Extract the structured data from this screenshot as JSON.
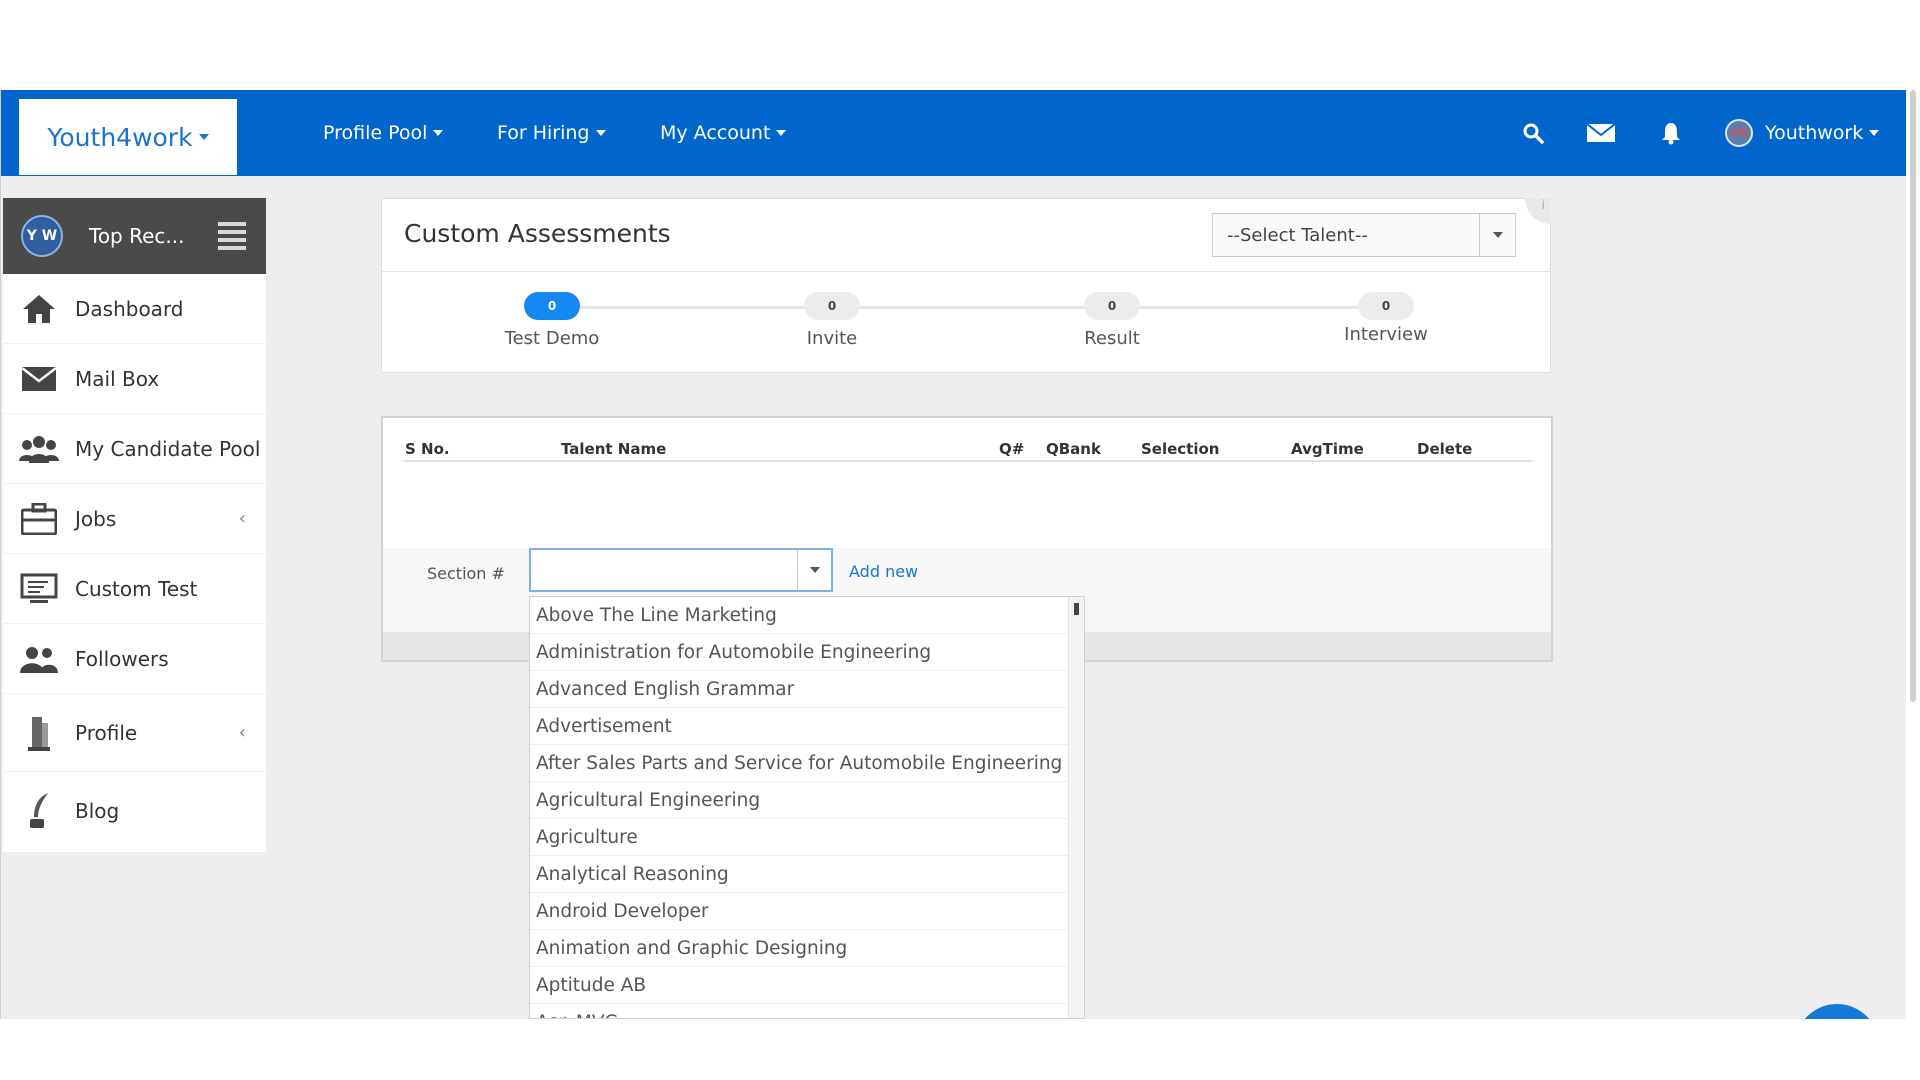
{
  "nav": {
    "brand": "Youth4work",
    "menus": [
      "Profile Pool",
      "For Hiring",
      "My Account"
    ],
    "user_initials": "YW",
    "user_name": "Youthwork"
  },
  "sidebar": {
    "avatar_initials": "Y W",
    "title": "Top Rec...",
    "items": [
      {
        "label": "Dashboard",
        "icon": "home-icon"
      },
      {
        "label": "Mail Box",
        "icon": "envelope-icon"
      },
      {
        "label": "My Candidate Pool",
        "icon": "group-icon"
      },
      {
        "label": "Jobs",
        "icon": "briefcase-icon"
      },
      {
        "label": "Custom Test",
        "icon": "monitor-icon"
      },
      {
        "label": "Followers",
        "icon": "users-icon"
      },
      {
        "label": "Profile",
        "icon": "profile-icon"
      },
      {
        "label": "Blog",
        "icon": "quill-icon"
      }
    ]
  },
  "main": {
    "title": "Custom Assessments",
    "talent_select": "--Select Talent--",
    "steps": [
      {
        "count": "0",
        "label": "Test Demo"
      },
      {
        "count": "0",
        "label": "Invite"
      },
      {
        "count": "0",
        "label": "Result"
      },
      {
        "count": "0",
        "label": "Interview"
      }
    ],
    "table_headers": {
      "sno": "S No.",
      "talent_name": "Talent Name",
      "q": "Q#",
      "qbank": "QBank",
      "selection": "Selection",
      "avgtime": "AvgTime",
      "delete": "Delete"
    },
    "section_label": "Section #",
    "section_value": "",
    "add_new": "Add new"
  },
  "dropdown": {
    "options": [
      "Above The Line Marketing",
      "Administration for Automobile Engineering",
      "Advanced English Grammar",
      "Advertisement",
      "After Sales Parts and Service for Automobile Engineering",
      "Agricultural Engineering",
      "Agriculture",
      "Analytical Reasoning",
      "Android Developer",
      "Animation and Graphic Designing",
      "Aptitude AB",
      "Asp MVC"
    ]
  },
  "colors": {
    "nav_bg": "#0066cc",
    "accent": "#1589f0",
    "sidebar_head": "#4a4a4a"
  }
}
